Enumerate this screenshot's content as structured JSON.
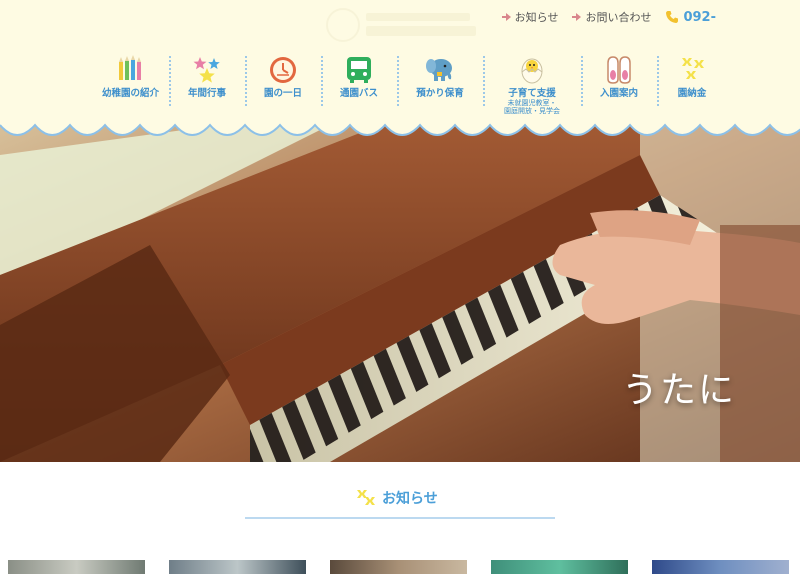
{
  "header": {
    "top_links": [
      {
        "label": "お知らせ"
      },
      {
        "label": "お問い合わせ"
      }
    ],
    "phone": "092-"
  },
  "nav": {
    "items": [
      {
        "label": "幼稚園の紹介",
        "icon": "colored-pencils-icon"
      },
      {
        "label": "年間行事",
        "icon": "stars-icon"
      },
      {
        "label": "園の一日",
        "icon": "clock-icon"
      },
      {
        "label": "通園バス",
        "icon": "bus-icon"
      },
      {
        "label": "預かり保育",
        "icon": "elephant-icon"
      },
      {
        "label": "子育て支援",
        "sub": [
          "未就園児教室・",
          "園庭開放・見学会"
        ],
        "icon": "chick-egg-icon"
      },
      {
        "label": "入園案内",
        "icon": "shoes-icon"
      },
      {
        "label": "園納金",
        "icon": "crosses-icon"
      }
    ]
  },
  "hero": {
    "caption": "うたに"
  },
  "news": {
    "title": "お知らせ"
  },
  "colors": {
    "header_bg": "#fefbe3",
    "accent_blue": "#4b9fd8",
    "scallop_blue": "#8cc0e8",
    "arrow_pink": "#d9868c"
  }
}
